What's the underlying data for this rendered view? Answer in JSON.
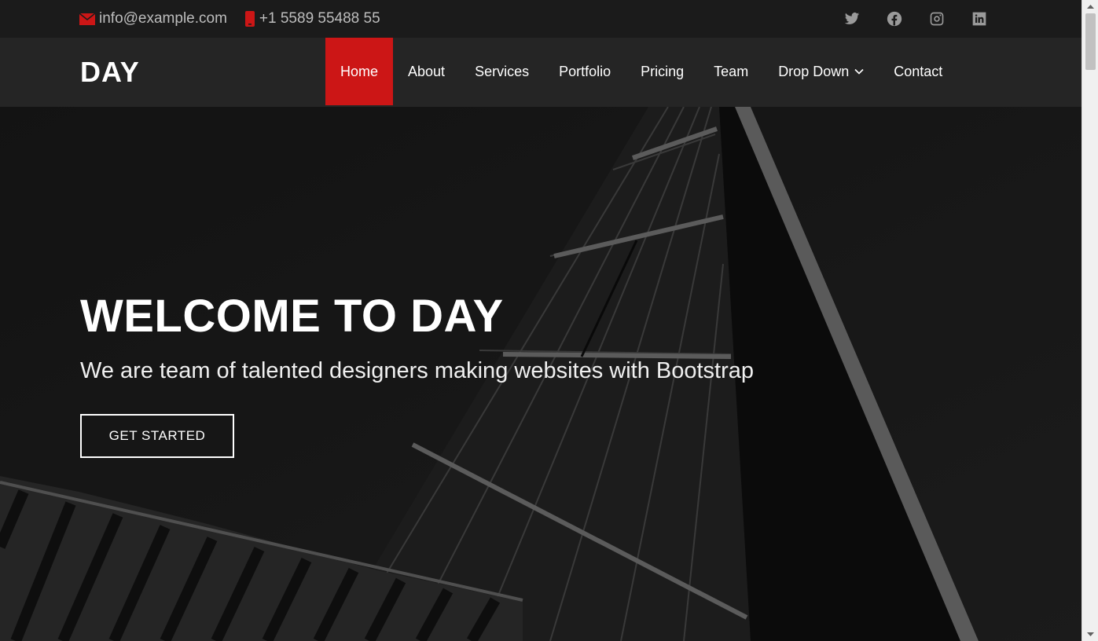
{
  "topbar": {
    "email": "info@example.com",
    "phone": "+1 5589 55488 55",
    "social_icons": [
      "twitter-icon",
      "facebook-icon",
      "instagram-icon",
      "linkedin-icon"
    ]
  },
  "header": {
    "logo": "DAY",
    "nav": [
      {
        "label": "Home",
        "active": true
      },
      {
        "label": "About"
      },
      {
        "label": "Services"
      },
      {
        "label": "Portfolio"
      },
      {
        "label": "Pricing"
      },
      {
        "label": "Team"
      },
      {
        "label": "Drop Down",
        "icon": "chevron-down-icon"
      },
      {
        "label": "Contact"
      }
    ]
  },
  "hero": {
    "title": "WELCOME TO DAY",
    "subtitle": "We are team of talented designers making websites with Bootstrap",
    "cta": "GET STARTED"
  },
  "colors": {
    "accent": "#cc1616",
    "topbar_bg": "#1b1b1b",
    "header_bg": "#252525"
  }
}
